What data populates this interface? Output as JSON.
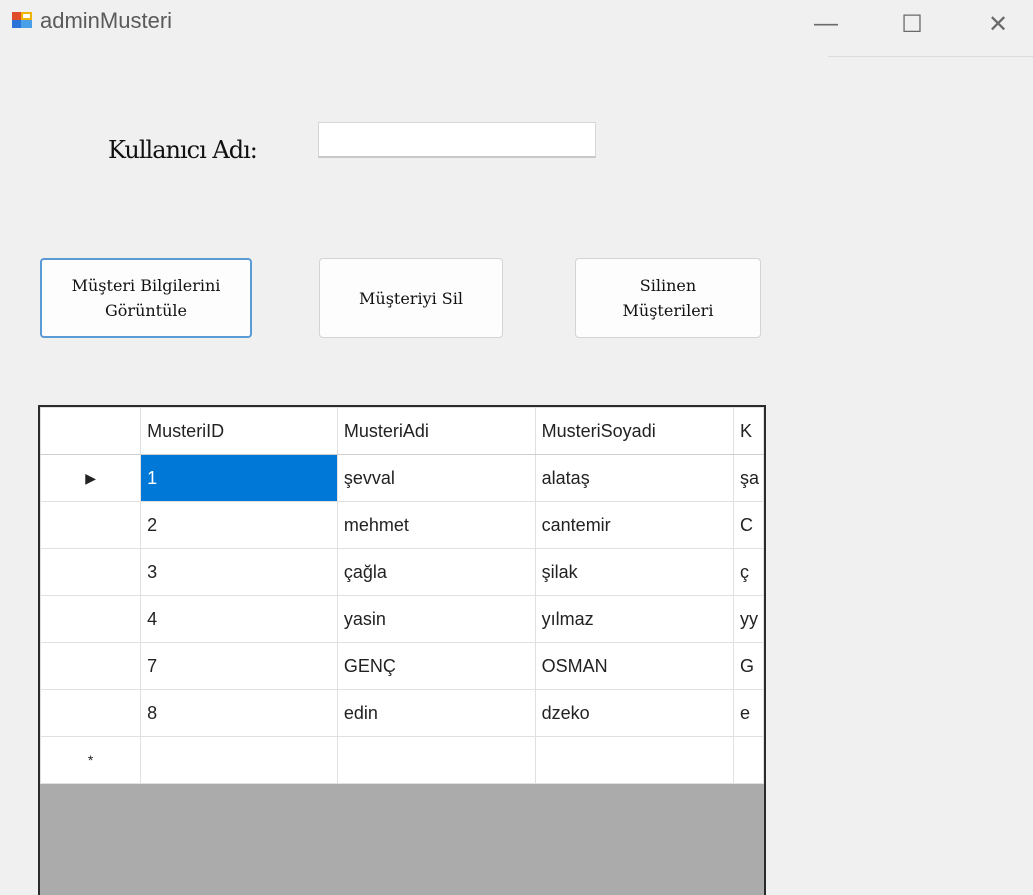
{
  "window": {
    "title": "adminMusteri",
    "minimize": "—",
    "maximize": "☐",
    "close": "✕"
  },
  "form": {
    "user_label": "Kullanıcı Adı:",
    "user_value": "",
    "view_button": "Müşteri Bilgilerini\nGörüntüle",
    "delete_button": "Müşteriyi Sil",
    "deleted_button": "Silinen\nMüşterileri"
  },
  "grid": {
    "columns": [
      "MusteriID",
      "MusteriAdi",
      "MusteriSoyadi",
      "K"
    ],
    "rows": [
      {
        "id": "1",
        "ad": "şevval",
        "soyad": "alataş",
        "k": "şa"
      },
      {
        "id": "2",
        "ad": "mehmet",
        "soyad": "cantemir",
        "k": "C"
      },
      {
        "id": "3",
        "ad": "çağla",
        "soyad": "şilak",
        "k": "ç"
      },
      {
        "id": "4",
        "ad": "yasin",
        "soyad": "yılmaz",
        "k": "yy"
      },
      {
        "id": "7",
        "ad": "GENÇ",
        "soyad": "OSMAN",
        "k": "G"
      },
      {
        "id": "8",
        "ad": "edin",
        "soyad": "dzeko",
        "k": "e"
      }
    ],
    "current_row_marker": "▶",
    "new_row_marker": "*"
  }
}
